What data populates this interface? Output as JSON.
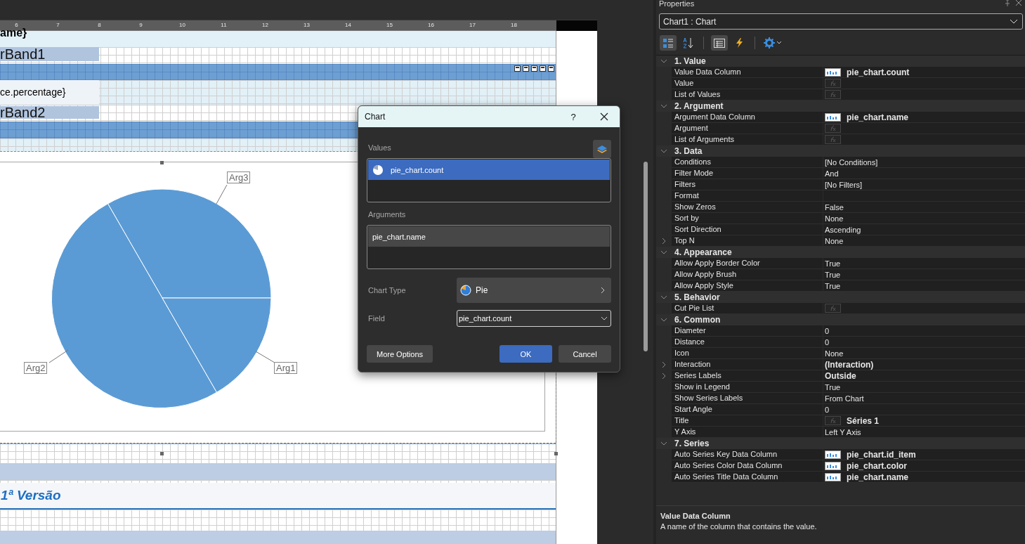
{
  "ruler": {
    "ticks": [
      "6",
      "7",
      "8",
      "9",
      "10",
      "11",
      "12",
      "13",
      "14",
      "15",
      "16",
      "17",
      "18"
    ]
  },
  "report": {
    "title_fragment": "ame}",
    "band_1": "rBand1",
    "field_fragment": "ce.percentage}",
    "band_2": "rBand2",
    "chart": {
      "labels": [
        {
          "text": "Arg3"
        },
        {
          "text": "Arg2"
        },
        {
          "text": "Arg1"
        }
      ]
    },
    "footer_title": "1ª Versão"
  },
  "dialog": {
    "title": "Chart",
    "help": "?",
    "values": {
      "label": "Values",
      "focused": true,
      "items": [
        {
          "text": "pie_chart.count",
          "selected": true
        }
      ]
    },
    "arguments": {
      "label": "Arguments",
      "focused": false,
      "items": [
        {
          "text": "pie_chart.name",
          "selected": true
        }
      ]
    },
    "chart_type_label": "Chart Type",
    "chart_type": "Pie",
    "field_label": "Field",
    "field_value": "pie_chart.count",
    "buttons": [
      {
        "label": "More Options",
        "kind": "option"
      },
      {
        "label": "OK",
        "kind": "primary"
      },
      {
        "label": "Cancel",
        "kind": "secondary"
      }
    ]
  },
  "properties": {
    "title": "Properties",
    "object": "Chart1 : Chart",
    "toolbar": [
      {
        "kind": "categorized",
        "selected": true
      },
      {
        "kind": "alphabetical",
        "selected": false
      },
      {
        "kind": "properties",
        "selected": true
      },
      {
        "kind": "events",
        "selected": false
      },
      {
        "kind": "settings",
        "selected": false
      }
    ],
    "groups": [
      {
        "title": "1. Value",
        "expanded": true,
        "rows": [
          {
            "name": "Value Data Column",
            "kind": "column",
            "value": "pie_chart.count"
          },
          {
            "name": "Value",
            "kind": "expression"
          },
          {
            "name": "List of Values",
            "kind": "expression"
          }
        ]
      },
      {
        "title": "2. Argument",
        "expanded": true,
        "rows": [
          {
            "name": "Argument Data Column",
            "kind": "column",
            "value": "pie_chart.name"
          },
          {
            "name": "Argument",
            "kind": "expression"
          },
          {
            "name": "List of Arguments",
            "kind": "expression"
          }
        ]
      },
      {
        "title": "3. Data",
        "expanded": true,
        "rows": [
          {
            "name": "Conditions",
            "kind": "text",
            "value": "[No Conditions]"
          },
          {
            "name": "Filter Mode",
            "kind": "text",
            "value": "And"
          },
          {
            "name": "Filters",
            "kind": "text",
            "value": "[No Filters]"
          },
          {
            "name": "Format",
            "kind": "text"
          },
          {
            "name": "Show Zeros",
            "kind": "text",
            "value": "False"
          },
          {
            "name": "Sort by",
            "kind": "text",
            "value": "None"
          },
          {
            "name": "Sort Direction",
            "kind": "text",
            "value": "Ascending"
          },
          {
            "name": "Top N",
            "kind": "text",
            "value": "None",
            "expander": true
          }
        ]
      },
      {
        "title": "4. Appearance",
        "expanded": true,
        "rows": [
          {
            "name": "Allow Apply Border Color",
            "kind": "text",
            "value": "True"
          },
          {
            "name": "Allow Apply Brush",
            "kind": "text",
            "value": "True"
          },
          {
            "name": "Allow Apply Style",
            "kind": "text",
            "value": "True"
          }
        ]
      },
      {
        "title": "5. Behavior",
        "expanded": true,
        "rows": [
          {
            "name": "Cut Pie List",
            "kind": "expression"
          }
        ]
      },
      {
        "title": "6. Common",
        "expanded": true,
        "rows": [
          {
            "name": "Diameter",
            "kind": "text",
            "value": "0"
          },
          {
            "name": "Distance",
            "kind": "text",
            "value": "0"
          },
          {
            "name": "Icon",
            "kind": "text",
            "value": "None"
          },
          {
            "name": "Interaction",
            "kind": "bold",
            "value": "(Interaction)",
            "expander": true
          },
          {
            "name": "Series Labels",
            "kind": "bold",
            "value": "Outside",
            "expander": true
          },
          {
            "name": "Show in Legend",
            "kind": "text",
            "value": "True"
          },
          {
            "name": "Show Series Labels",
            "kind": "text",
            "value": "From Chart"
          },
          {
            "name": "Start Angle",
            "kind": "text",
            "value": "0"
          },
          {
            "name": "Title",
            "kind": "expression",
            "value": "Séries 1"
          },
          {
            "name": "Y Axis",
            "kind": "text",
            "value": "Left Y Axis"
          }
        ]
      },
      {
        "title": "7. Series",
        "expanded": true,
        "rows": [
          {
            "name": "Auto Series Key Data Column",
            "kind": "column",
            "value": "pie_chart.id_item"
          },
          {
            "name": "Auto Series Color Data Column",
            "kind": "column",
            "value": "pie_chart.color"
          },
          {
            "name": "Auto Series Title Data Column",
            "kind": "column",
            "value": "pie_chart.name"
          }
        ]
      }
    ],
    "description": {
      "title": "Value Data Column",
      "text": "A name of the column that contains the value."
    }
  }
}
